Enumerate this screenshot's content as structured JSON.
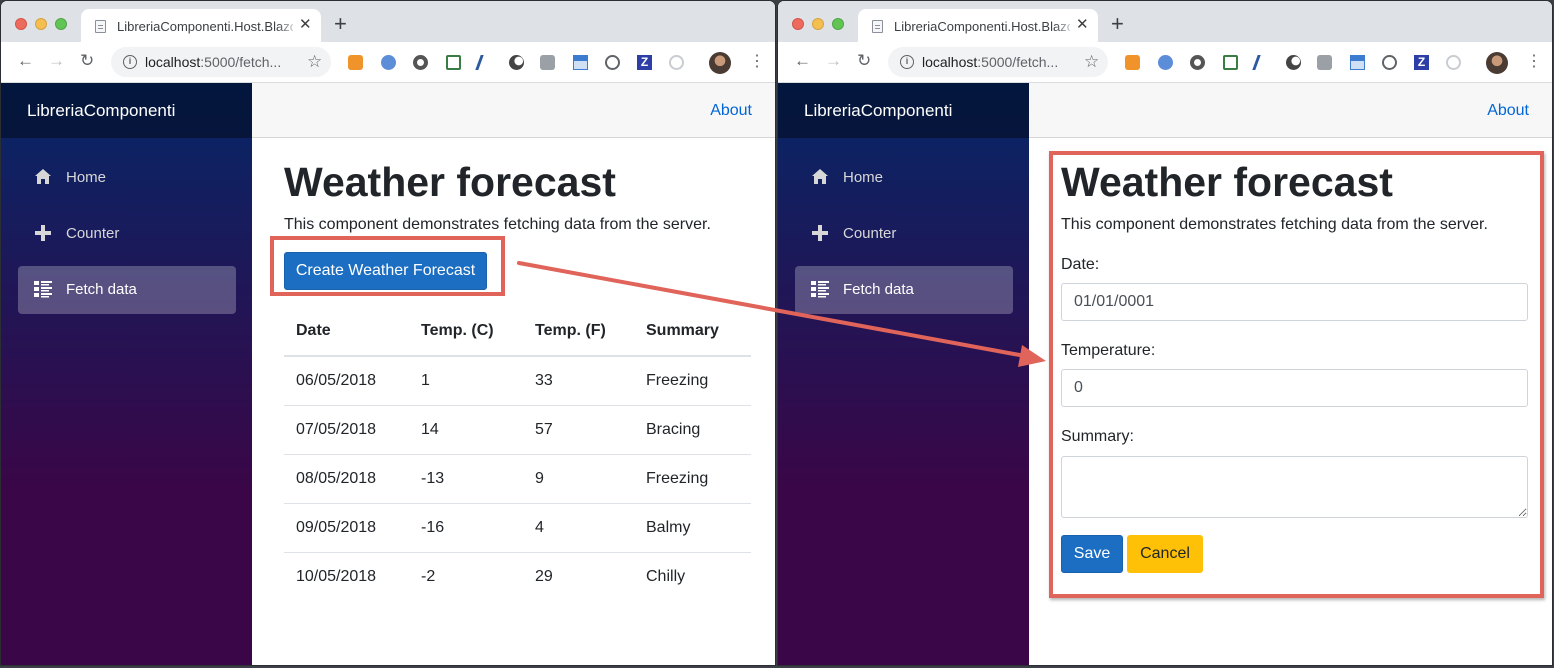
{
  "colors": {
    "annotation": "#e0645a",
    "primary": "#1b6ec2",
    "warning": "#ffc107",
    "link": "#0366d6"
  },
  "browser": {
    "tab_title": "LibreriaComponenti.Host.Blazor",
    "url_host": "localhost",
    "url_path": ":5000/fetch...",
    "extensions": [
      "orange-ext-icon",
      "blue-ext-icon",
      "circle-ext-icon",
      "doc-ext-icon",
      "fork-ext-icon",
      "moon-ext-icon",
      "chat-ext-icon",
      "layout-ext-icon",
      "code-ext-icon",
      "z-ext-icon",
      "timer-ext-icon"
    ]
  },
  "app": {
    "brand": "LibreriaComponenti",
    "about": "About",
    "nav": [
      {
        "label": "Home",
        "icon": "home-icon"
      },
      {
        "label": "Counter",
        "icon": "plus-icon"
      },
      {
        "label": "Fetch data",
        "icon": "list-icon"
      }
    ]
  },
  "left_page": {
    "title": "Weather forecast",
    "lead": "This component demonstrates fetching data from the server.",
    "create_button": "Create Weather Forecast",
    "table": {
      "headers": [
        "Date",
        "Temp. (C)",
        "Temp. (F)",
        "Summary"
      ],
      "rows": [
        [
          "06/05/2018",
          "1",
          "33",
          "Freezing"
        ],
        [
          "07/05/2018",
          "14",
          "57",
          "Bracing"
        ],
        [
          "08/05/2018",
          "-13",
          "9",
          "Freezing"
        ],
        [
          "09/05/2018",
          "-16",
          "4",
          "Balmy"
        ],
        [
          "10/05/2018",
          "-2",
          "29",
          "Chilly"
        ]
      ]
    }
  },
  "right_page": {
    "title": "Weather forecast",
    "lead": "This component demonstrates fetching data from the server.",
    "date_label": "Date:",
    "date_value": "01/01/0001",
    "temperature_label": "Temperature:",
    "temperature_value": "0",
    "summary_label": "Summary:",
    "summary_value": "",
    "save": "Save",
    "cancel": "Cancel"
  }
}
